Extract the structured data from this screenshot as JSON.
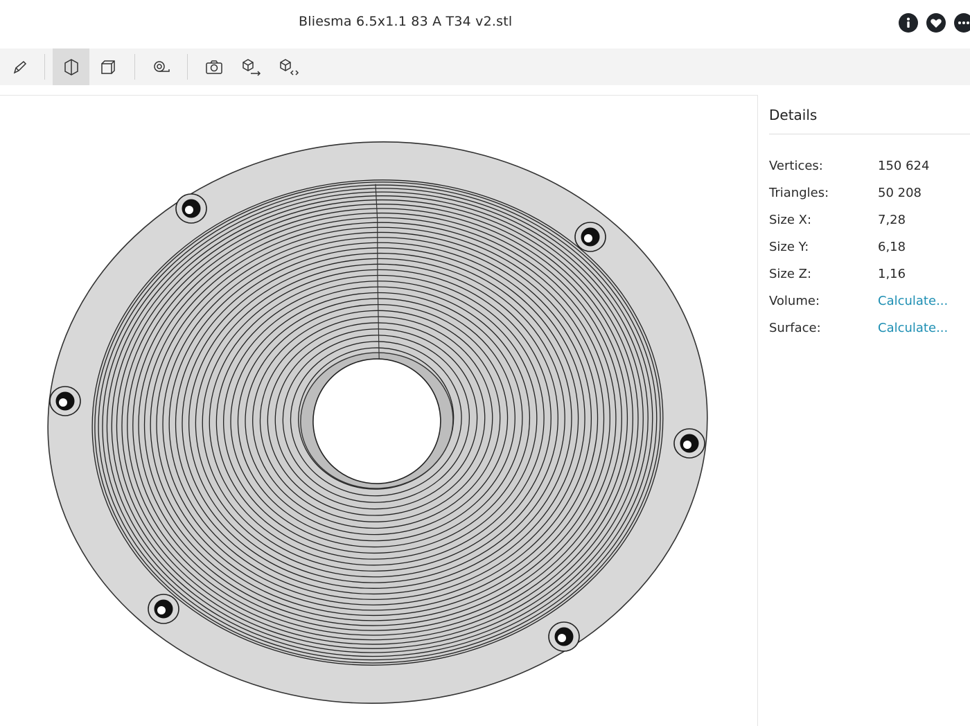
{
  "title": "Bliesma 6.5x1.1 83 A T34 v2.stl",
  "header_icons": [
    "info-icon",
    "heart-icon",
    "more-icon"
  ],
  "toolbar": {
    "buttons": [
      "pen-icon",
      "cube-shaded-icon",
      "cube-wireframe-icon",
      "measure-tape-icon",
      "camera-icon",
      "export-model-icon",
      "embed-code-icon"
    ],
    "active": "cube-shaded-icon"
  },
  "details": {
    "heading": "Details",
    "rows": [
      {
        "label": "Vertices:",
        "value": "150 624"
      },
      {
        "label": "Triangles:",
        "value": "50 208"
      },
      {
        "label": "Size X:",
        "value": "7,28"
      },
      {
        "label": "Size Y:",
        "value": "6,18"
      },
      {
        "label": "Size Z:",
        "value": "1,16"
      },
      {
        "label": "Volume:",
        "value": "Calculate..."
      },
      {
        "label": "Surface:",
        "value": "Calculate..."
      }
    ]
  },
  "colors": {
    "link": "#1e8fb3",
    "model_fill": "#d8d8d8",
    "toolbar_bg": "#f3f3f3"
  }
}
